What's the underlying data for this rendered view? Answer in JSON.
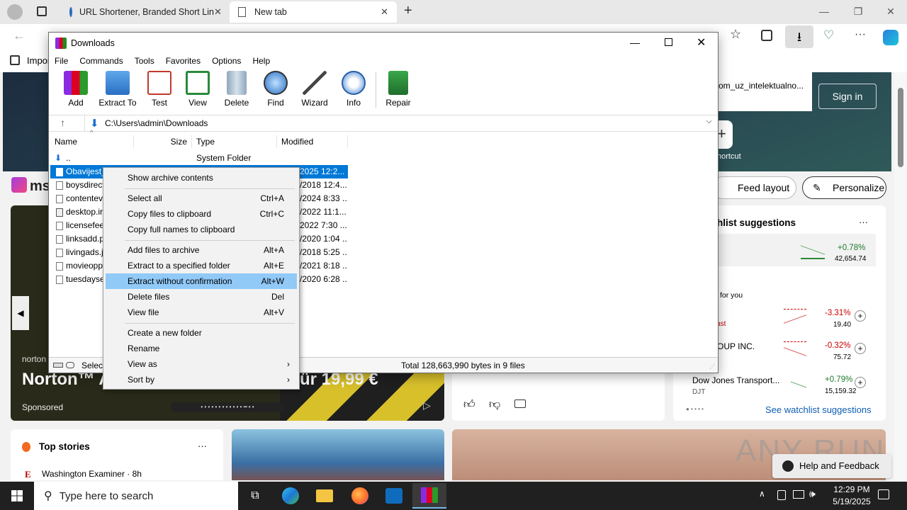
{
  "edge": {
    "tabs": [
      {
        "label": "URL Shortener, Branded Short Lin"
      },
      {
        "label": "New tab"
      }
    ],
    "favorites_import": "Impor",
    "sign_in": "Sign in",
    "page_snippet": "om_uz_intelektualno...",
    "shortcut_label": "hortcut",
    "logo_text": "ms",
    "feed_layout": "Feed layout",
    "personalize": "Personalize",
    "watchlist_title": "tchlist suggestions",
    "for_you": "for you",
    "ticker1": {
      "pct": "+0.78%",
      "val": "42,654.74"
    },
    "ticker2": {
      "pct": "-3.31%",
      "val": "19.40",
      "note": "g fast"
    },
    "ticker3": {
      "name": "OUP INC.",
      "pct": "-0.32%",
      "val": "75.72"
    },
    "ticker4": {
      "name": "Dow Jones Transport...",
      "sym": "DJT",
      "pct": "+0.79%",
      "val": "15,159.32"
    },
    "see_watchlist": "See watchlist suggestions",
    "ad_brand": "norton",
    "ad_headline_left": "Norton™ A",
    "ad_headline_right": "ür 19,99 €",
    "sponsored": "Sponsored",
    "top_stories": "Top stories",
    "story_source": "Washington Examiner · 8h",
    "watermark": "ANY RUN",
    "help_feedback": "Help and Feedback",
    "more": "···"
  },
  "winrar": {
    "title": "Downloads",
    "menu": [
      "File",
      "Commands",
      "Tools",
      "Favorites",
      "Options",
      "Help"
    ],
    "toolbar": [
      "Add",
      "Extract To",
      "Test",
      "View",
      "Delete",
      "Find",
      "Wizard",
      "Info",
      "Repair"
    ],
    "path": "C:\\Users\\admin\\Downloads",
    "columns": {
      "name": "Name",
      "size": "Size",
      "type": "Type",
      "modified": "Modified"
    },
    "parent": {
      "name": "..",
      "type": "System Folder"
    },
    "files": [
      {
        "name": "Obavijest_",
        "modified": "2025 12:2..."
      },
      {
        "name": "boysdirect",
        "modified": "/2018 12:4..."
      },
      {
        "name": "contentev",
        "modified": "/2024 8:33 ..."
      },
      {
        "name": "desktop.ir",
        "modified": "/2022 11:1..."
      },
      {
        "name": "licensefee",
        "modified": "2022 7:30 ..."
      },
      {
        "name": "linksadd.p",
        "modified": "/2020 1:04 ..."
      },
      {
        "name": "livingads.j",
        "modified": "/2018 5:25 ..."
      },
      {
        "name": "movieopp",
        "modified": "/2021 8:18 ..."
      },
      {
        "name": "tuesdayse",
        "modified": "/2020 6:28 ..."
      }
    ],
    "status_left": "Select",
    "status_total": "Total 128,663,990 bytes in 9 files"
  },
  "context_menu": [
    {
      "label": "Show archive contents",
      "shortcut": ""
    },
    {
      "label": "Select all",
      "shortcut": "Ctrl+A"
    },
    {
      "label": "Copy files to clipboard",
      "shortcut": "Ctrl+C"
    },
    {
      "label": "Copy full names to clipboard",
      "shortcut": ""
    },
    {
      "label": "Add files to archive",
      "shortcut": "Alt+A"
    },
    {
      "label": "Extract to a specified folder",
      "shortcut": "Alt+E"
    },
    {
      "label": "Extract without confirmation",
      "shortcut": "Alt+W"
    },
    {
      "label": "Delete files",
      "shortcut": "Del"
    },
    {
      "label": "View file",
      "shortcut": "Alt+V"
    },
    {
      "label": "Create a new folder",
      "shortcut": ""
    },
    {
      "label": "Rename",
      "shortcut": ""
    },
    {
      "label": "View as",
      "shortcut": ""
    },
    {
      "label": "Sort by",
      "shortcut": ""
    }
  ],
  "taskbar": {
    "search_placeholder": "Type here to search",
    "time": "12:29 PM",
    "date": "5/19/2025"
  }
}
